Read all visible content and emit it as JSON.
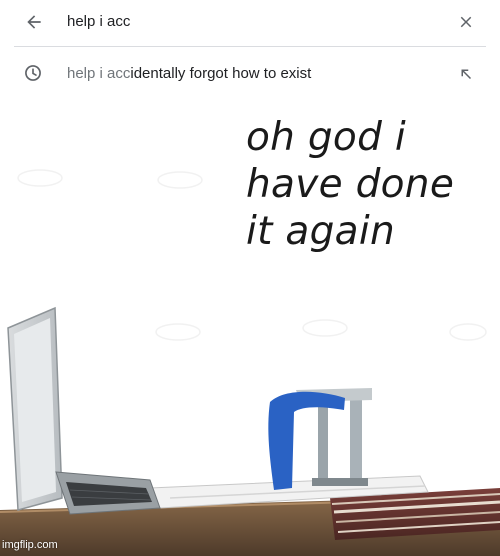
{
  "search": {
    "query": "help i acc",
    "back_icon": "arrow-left-icon",
    "clear_icon": "close-icon"
  },
  "suggestion": {
    "typed_part": "help i acc",
    "completion_part": "identally forgot how to exist",
    "history_icon": "history-clock-icon",
    "fill_icon": "arrow-up-left-icon"
  },
  "meme": {
    "caption_lines": [
      "oh god i",
      "have done",
      "it again"
    ],
    "watermark": "imgflip.com"
  },
  "colors": {
    "text_primary": "#202124",
    "text_secondary": "#70757a",
    "divider": "#dadce0",
    "scribble_blue": "#2a62c4"
  }
}
